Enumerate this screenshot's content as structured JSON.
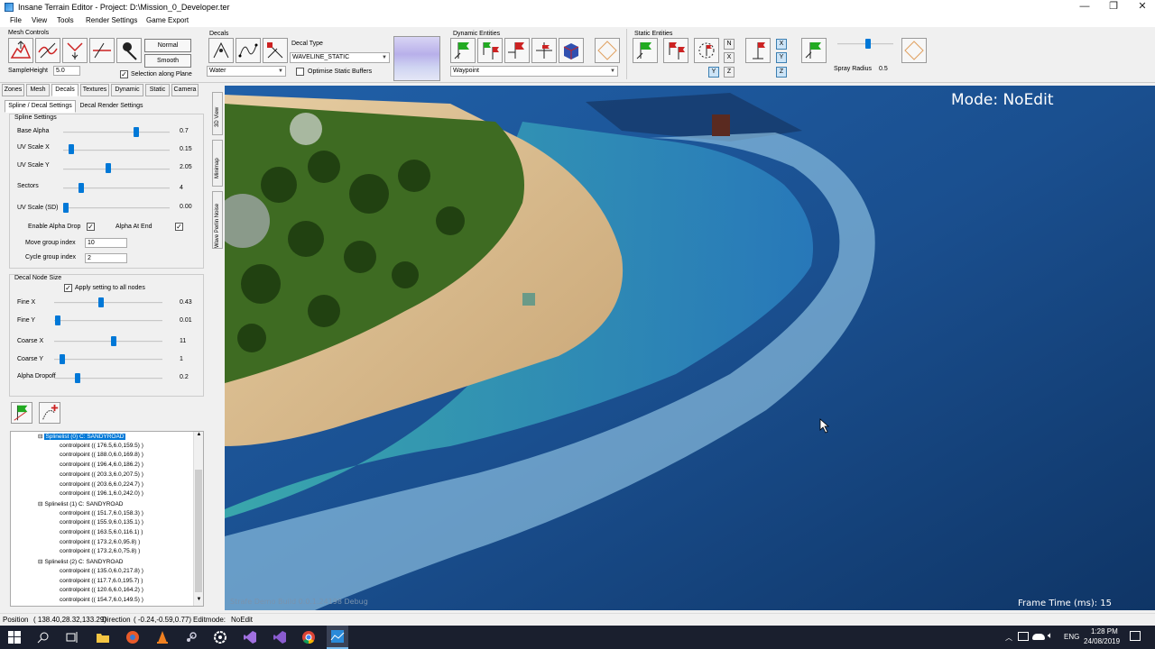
{
  "window": {
    "title": "Insane Terrain Editor - Project: D:\\Mission_0_Developer.ter",
    "minimize": "—",
    "maximize": "❐",
    "close": "✕"
  },
  "menu": [
    "File",
    "View",
    "Tools",
    "Render Settings",
    "Game Export"
  ],
  "toolbar": {
    "mesh_controls": {
      "label": "Mesh Controls",
      "normal": "Normal",
      "smooth": "Smooth",
      "sample_height_label": "SampleHeight",
      "sample_height_value": "5.0",
      "selection_along_plane": "Selection along Plane",
      "selection_checked": true
    },
    "decals": {
      "label": "Decals",
      "combo": "Water",
      "decal_type_label": "Decal Type",
      "decal_type_value": "WAVELINE_STATIC",
      "optimise_label": "Optimise Static Buffers",
      "optimise_checked": false
    },
    "dynamic_entities": {
      "label": "Dynamic Entities",
      "combo": "Waypoint"
    },
    "static_entities": {
      "label": "Static Entities",
      "axes1": [
        "N",
        "X",
        "Y",
        "Z"
      ],
      "axes2": [
        "X",
        "Y",
        "Z"
      ],
      "spray_radius_label": "Spray Radius",
      "spray_radius_value": "0.5",
      "spray_level": 0.55
    }
  },
  "left_tabs": [
    "Zones",
    "Mesh",
    "Decals",
    "Textures",
    "Dynamic",
    "Static",
    "Camera"
  ],
  "sub_tabs": [
    "Spline / Decal Settings",
    "Decal Render Settings"
  ],
  "side_tabs": [
    "3D View",
    "Minimap",
    "Wave Perlin Noise"
  ],
  "spline_settings": {
    "title": "Spline Settings",
    "sliders": [
      {
        "label": "Base Alpha",
        "value": "0.7",
        "level": 0.7
      },
      {
        "label": "UV Scale X",
        "value": "0.15",
        "level": 0.05
      },
      {
        "label": "UV Scale Y",
        "value": "2.05",
        "level": 0.42
      },
      {
        "label": "Sectors",
        "value": "4",
        "level": 0.15
      },
      {
        "label": "UV Scale (SD)",
        "value": "0.00",
        "level": 0.0
      }
    ],
    "enable_alpha_drop": "Enable Alpha Drop",
    "alpha_at_end": "Alpha At End",
    "move_group_label": "Move group index",
    "move_group_value": "10",
    "cycle_group_label": "Cycle group index",
    "cycle_group_value": "2"
  },
  "node_size": {
    "title": "Decal Node Size",
    "apply_all": "Apply setting to all nodes",
    "sliders": [
      {
        "label": "Fine X",
        "value": "0.43",
        "level": 0.43
      },
      {
        "label": "Fine Y",
        "value": "0.01",
        "level": 0.01
      },
      {
        "label": "Coarse X",
        "value": "11",
        "level": 0.55
      },
      {
        "label": "Coarse Y",
        "value": "1",
        "level": 0.05
      },
      {
        "label": "Alpha Dropoff",
        "value": "0.2",
        "level": 0.2
      }
    ]
  },
  "tree": [
    {
      "label": "Splinelist (0) C: SANDYROAD",
      "selected": true,
      "children": [
        "controlpoint (( 176.5,6.0,159.5) )",
        "controlpoint (( 188.0,6.0,169.8) )",
        "controlpoint (( 196.4,6.0,186.2) )",
        "controlpoint (( 203.3,6.0,207.5) )",
        "controlpoint (( 203.6,6.0,224.7) )",
        "controlpoint (( 196.1,6.0,242.0) )"
      ]
    },
    {
      "label": "Splinelist (1) C: SANDYROAD",
      "selected": false,
      "children": [
        "controlpoint (( 151.7,6.0,158.3) )",
        "controlpoint (( 155.9,6.0,135.1) )",
        "controlpoint (( 163.5,6.0,116.1) )",
        "controlpoint (( 173.2,6.0,95.8) )",
        "controlpoint (( 173.2,6.0,75.8) )"
      ]
    },
    {
      "label": "Splinelist (2) C: SANDYROAD",
      "selected": false,
      "children": [
        "controlpoint (( 135.0,6.0,217.8) )",
        "controlpoint (( 117.7,6.0,195.7) )",
        "controlpoint (( 120.6,6.0,164.2) )",
        "controlpoint (( 154.7,6.0,149.5) )"
      ]
    }
  ],
  "viewport": {
    "mode": "Mode: NoEdit",
    "build": "Strafe Demo Build 0.0.1.24198 Debug",
    "frame_time": "Frame Time (ms): 15"
  },
  "status": {
    "position_label": "Position",
    "position_value": "( 138.40,28.32,133.29)",
    "direction_label": "Direction",
    "direction_value": "( -0.24,-0.59,0.77)",
    "editmode_label": "Editmode:",
    "editmode_value": "NoEdit"
  },
  "taskbar": {
    "lang": "ENG",
    "time": "1:28 PM",
    "date": "24/08/2019"
  },
  "colors": {
    "accent": "#0078d7",
    "taskbar": "#1a1f2e",
    "ocean": "#1a4f8f",
    "sand": "#d8b88a"
  }
}
